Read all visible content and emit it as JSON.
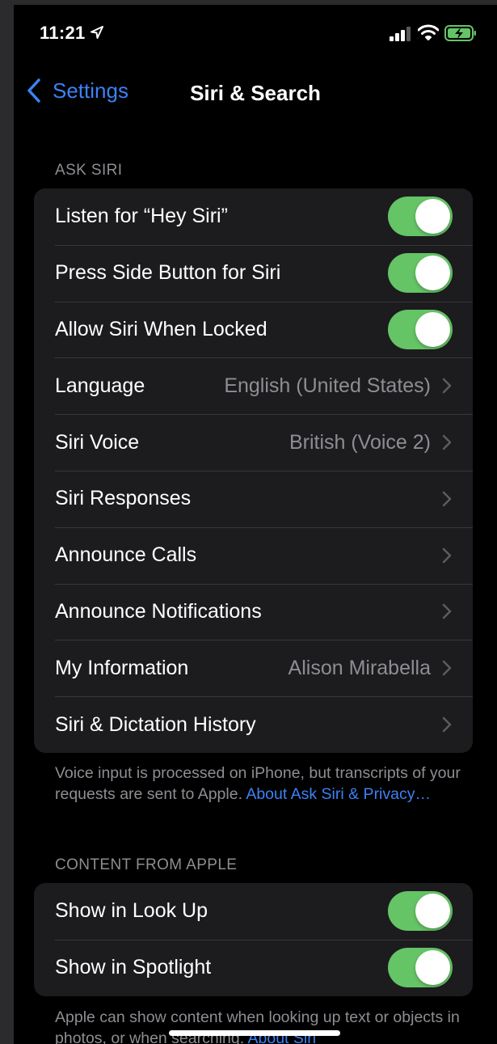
{
  "status_bar": {
    "time": "11:21",
    "location_icon": "location-arrow-icon",
    "signal_icon": "cellular-signal-icon",
    "wifi_icon": "wifi-icon",
    "battery_icon": "battery-charging-icon",
    "battery_color": "#65c466"
  },
  "nav": {
    "back_label": "Settings",
    "title": "Siri & Search",
    "accent_color": "#3b82f6"
  },
  "ask_siri": {
    "header": "ASK SIRI",
    "rows": [
      {
        "label": "Listen for “Hey Siri”",
        "type": "toggle",
        "on": true
      },
      {
        "label": "Press Side Button for Siri",
        "type": "toggle",
        "on": true
      },
      {
        "label": "Allow Siri When Locked",
        "type": "toggle",
        "on": true
      },
      {
        "label": "Language",
        "type": "disclosure",
        "value": "English (United States)"
      },
      {
        "label": "Siri Voice",
        "type": "disclosure",
        "value": "British (Voice 2)"
      },
      {
        "label": "Siri Responses",
        "type": "disclosure"
      },
      {
        "label": "Announce Calls",
        "type": "disclosure"
      },
      {
        "label": "Announce Notifications",
        "type": "disclosure"
      },
      {
        "label": "My Information",
        "type": "disclosure",
        "value": "Alison Mirabella"
      },
      {
        "label": "Siri & Dictation History",
        "type": "disclosure"
      }
    ],
    "footer_text": "Voice input is processed on iPhone, but transcripts of your requests are sent to Apple.",
    "footer_link": "About Ask Siri & Privacy…"
  },
  "content_from_apple": {
    "header": "CONTENT FROM APPLE",
    "rows": [
      {
        "label": "Show in Look Up",
        "type": "toggle",
        "on": true
      },
      {
        "label": "Show in Spotlight",
        "type": "toggle",
        "on": true
      }
    ],
    "footer_text": "Apple can show content when looking up text or objects in photos, or when searching.",
    "footer_link": "About Siri"
  },
  "colors": {
    "toggle_on": "#65c466",
    "group_background": "#1c1c1e",
    "secondary_text": "#8d8d93"
  }
}
